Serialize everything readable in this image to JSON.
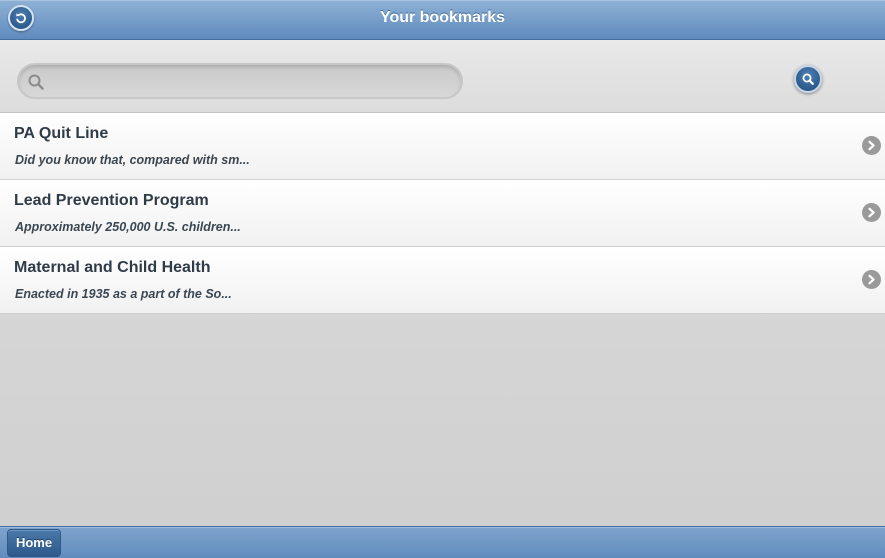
{
  "header": {
    "title": "Your bookmarks"
  },
  "search": {
    "placeholder": "",
    "value": ""
  },
  "bookmarks": [
    {
      "title": "PA Quit Line",
      "description": "Did you know that, compared with sm..."
    },
    {
      "title": "Lead Prevention Program",
      "description": "Approximately 250,000 U.S. children..."
    },
    {
      "title": "Maternal and Child Health",
      "description": "Enacted in 1935 as a part of the So..."
    }
  ],
  "footer": {
    "home_label": "Home"
  },
  "icons": {
    "back": "back-arrow-icon",
    "search_field": "magnifier-icon",
    "search_button": "search-icon",
    "row": "chevron-right-icon"
  },
  "colors": {
    "header_bar": "#6f97c5",
    "title_text": "#ffffff",
    "item_title": "#2f3c48",
    "item_desc": "#3a4752",
    "button_blue": "#2d5a8a"
  }
}
